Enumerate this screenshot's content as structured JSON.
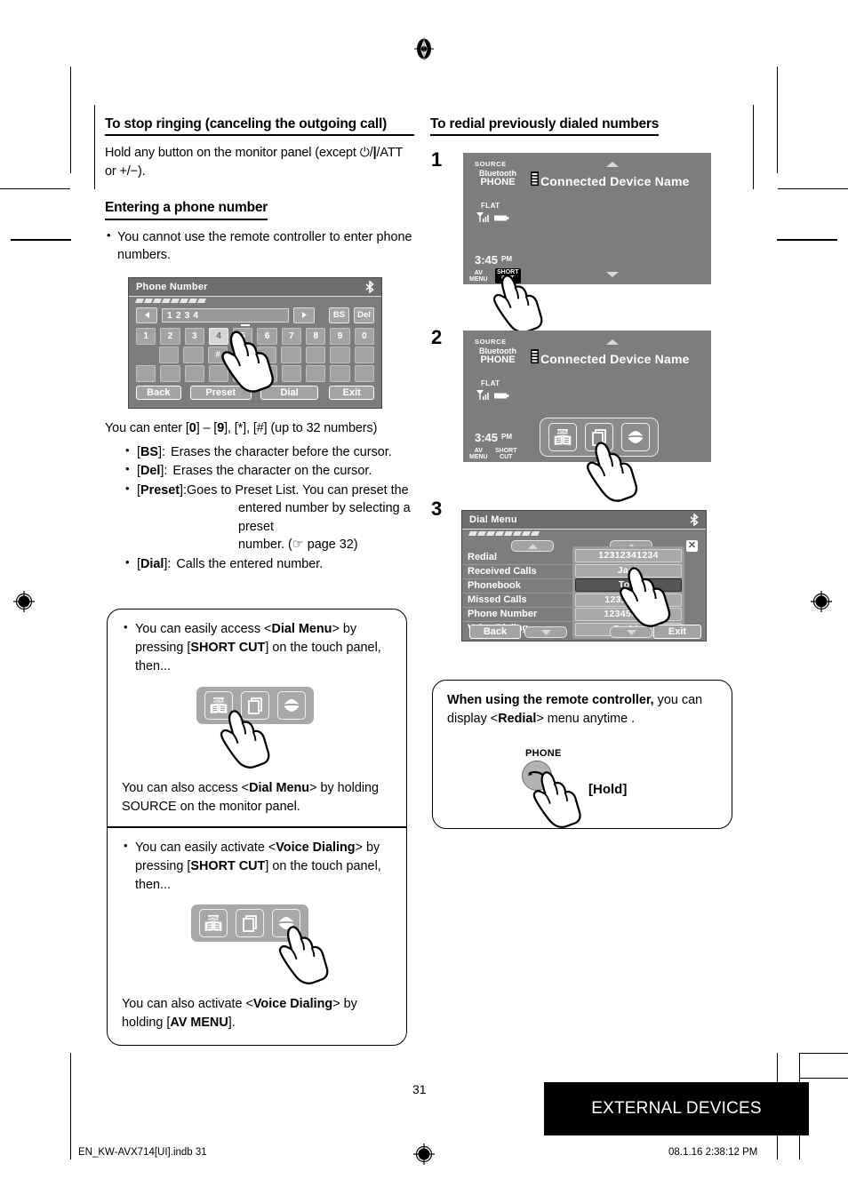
{
  "page": {
    "number": "31",
    "chapter_label": "EXTERNAL DEVICES",
    "file_meta": "EN_KW-AVX714[UI].indb   31",
    "date_meta": "08.1.16   2:38:12 PM"
  },
  "left": {
    "section1": {
      "heading": "To stop ringing (canceling the outgoing call)",
      "body": "Hold any button on the monitor panel (except ⏻/|/ATT or +/−)."
    },
    "section2": {
      "heading": "Entering a phone number",
      "bullets": [
        "You cannot use the remote controller to enter phone numbers."
      ],
      "intro": "You can enter [0] – [9], [*], [#] (up to 32 numbers)",
      "defs": [
        {
          "term": "[BS]:",
          "desc": "Erases the character before the cursor."
        },
        {
          "term": "[Del]:",
          "desc": "Erases the character on the cursor."
        },
        {
          "term": "[Preset]:",
          "desc": "Goes to Preset List. You can preset the"
        },
        {
          "term": "[Dial]:",
          "desc": "Calls the entered number."
        }
      ],
      "preset_cont1": "entered number by selecting a preset",
      "preset_cont2": "number. (☞ page 32)"
    },
    "keypad_screen": {
      "title": "Phone Number",
      "bluetooth_icon": "bluetooth-icon",
      "entered_number": "1 2 3 4",
      "left_arrow": "◀",
      "right_arrow": "▶",
      "bs_label": "BS",
      "del_label": "Del",
      "number_row": [
        "1",
        "2",
        "3",
        "4",
        "5",
        "6",
        "7",
        "8",
        "9",
        "0"
      ],
      "selected_key": "4",
      "hash_key": "#",
      "star_key": "*",
      "back_label": "Back",
      "preset_label": "Preset",
      "dial_label": "Dial",
      "exit_label": "Exit"
    },
    "note_dial": {
      "bullet_pre": "You can easily access <",
      "bullet_bold": "Dial Menu",
      "bullet_mid": "> by pressing [",
      "bullet_bold2": "SHORT CUT",
      "bullet_post": "] on the touch panel, then...",
      "footer_pre": "You can also access <",
      "footer_bold": "Dial Menu",
      "footer_post": "> by holding SOURCE on the monitor panel.",
      "icons": [
        "menu-book-icon",
        "copy-pages-icon",
        "lips-voice-icon"
      ],
      "pressed_icon": "menu-book-icon"
    },
    "note_voice": {
      "bullet_pre": "You can easily activate <",
      "bullet_bold": "Voice Dialing",
      "bullet_mid": "> by pressing [",
      "bullet_bold2": "SHORT CUT",
      "bullet_post": "] on the touch panel, then...",
      "footer_pre": "You can also activate <",
      "footer_bold": "Voice Dialing",
      "footer_post": "> by holding [",
      "footer_bold2": "AV MENU",
      "footer_end": "].",
      "icons": [
        "menu-book-icon",
        "copy-pages-icon",
        "lips-voice-icon"
      ],
      "pressed_icon": "lips-voice-icon"
    }
  },
  "right": {
    "heading": "To redial previously dialed numbers",
    "steps": [
      "1",
      "2",
      "3"
    ],
    "screen1": {
      "source_label": "SOURCE",
      "bluetooth_label": "Bluetooth",
      "phone_label": "PHONE",
      "device_name": "Connected Device Name",
      "flat_label": "FLAT",
      "time": "3:45",
      "ampm": "PM",
      "av_menu_label": "AV\nMENU",
      "short_cut_label": "SHORT\nCUT",
      "highlighted_button": "SHORT CUT"
    },
    "screen2": {
      "source_label": "SOURCE",
      "bluetooth_label": "Bluetooth",
      "phone_label": "PHONE",
      "device_name": "Connected Device Name",
      "flat_label": "FLAT",
      "time": "3:45",
      "ampm": "PM",
      "av_menu_label": "AV\nMENU",
      "short_cut_label": "SHORT\nCUT",
      "icons": [
        "menu-book-icon",
        "copy-pages-icon",
        "lips-voice-icon"
      ],
      "pressed_icon": "copy-pages-icon"
    },
    "screen3": {
      "title": "Dial Menu",
      "bluetooth_icon": "bluetooth-icon",
      "menu_items": [
        "Redial",
        "Received Calls",
        "Phonebook",
        "Missed Calls",
        "Phone Number",
        "Voice Dialing"
      ],
      "redial_entries": [
        "12312341234",
        "Jack",
        "Tom",
        "123111122",
        "123456789",
        "Daddy"
      ],
      "selected_entry": "Tom",
      "back_label": "Back",
      "exit_label": "Exit",
      "close_label": "✕"
    },
    "note_remote": {
      "bold": "When using the remote controller,",
      "rest_pre": " you can display <",
      "bold2": "Redial",
      "rest_post": "> menu anytime .",
      "phone_label": "PHONE",
      "hold_label": "[Hold]"
    }
  }
}
